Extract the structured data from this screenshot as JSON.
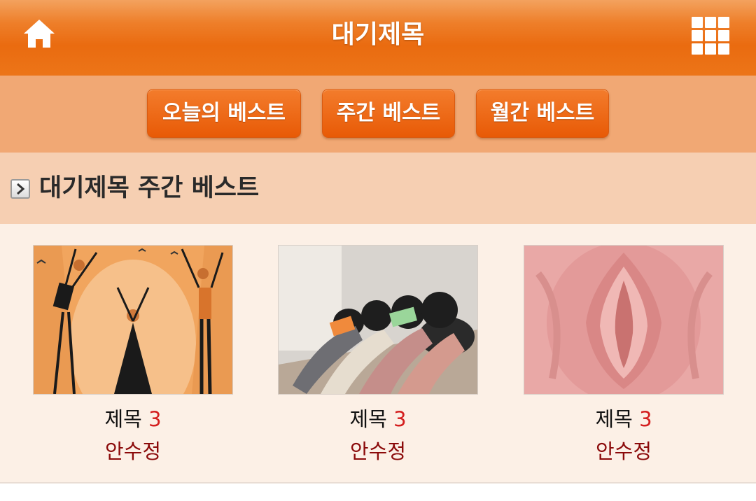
{
  "header": {
    "title": "대기제목",
    "home_icon": "home-icon",
    "menu_icon": "grid-menu-icon"
  },
  "tabs": [
    {
      "label": "오늘의 베스트"
    },
    {
      "label": "주간 베스트"
    },
    {
      "label": "월간 베스트"
    }
  ],
  "section": {
    "title": "대기제목 주간 베스트",
    "icon": "arrow-right-icon"
  },
  "items": [
    {
      "title": "제목",
      "count": "3",
      "author": "안수정"
    },
    {
      "title": "제목",
      "count": "3",
      "author": "안수정"
    },
    {
      "title": "제목",
      "count": "3",
      "author": "안수정"
    }
  ],
  "colors": {
    "header": "#ec7518",
    "tab_bar": "#f1a874",
    "section": "#f6cfb2",
    "count": "#d41f1f",
    "author": "#8b0a0a"
  }
}
